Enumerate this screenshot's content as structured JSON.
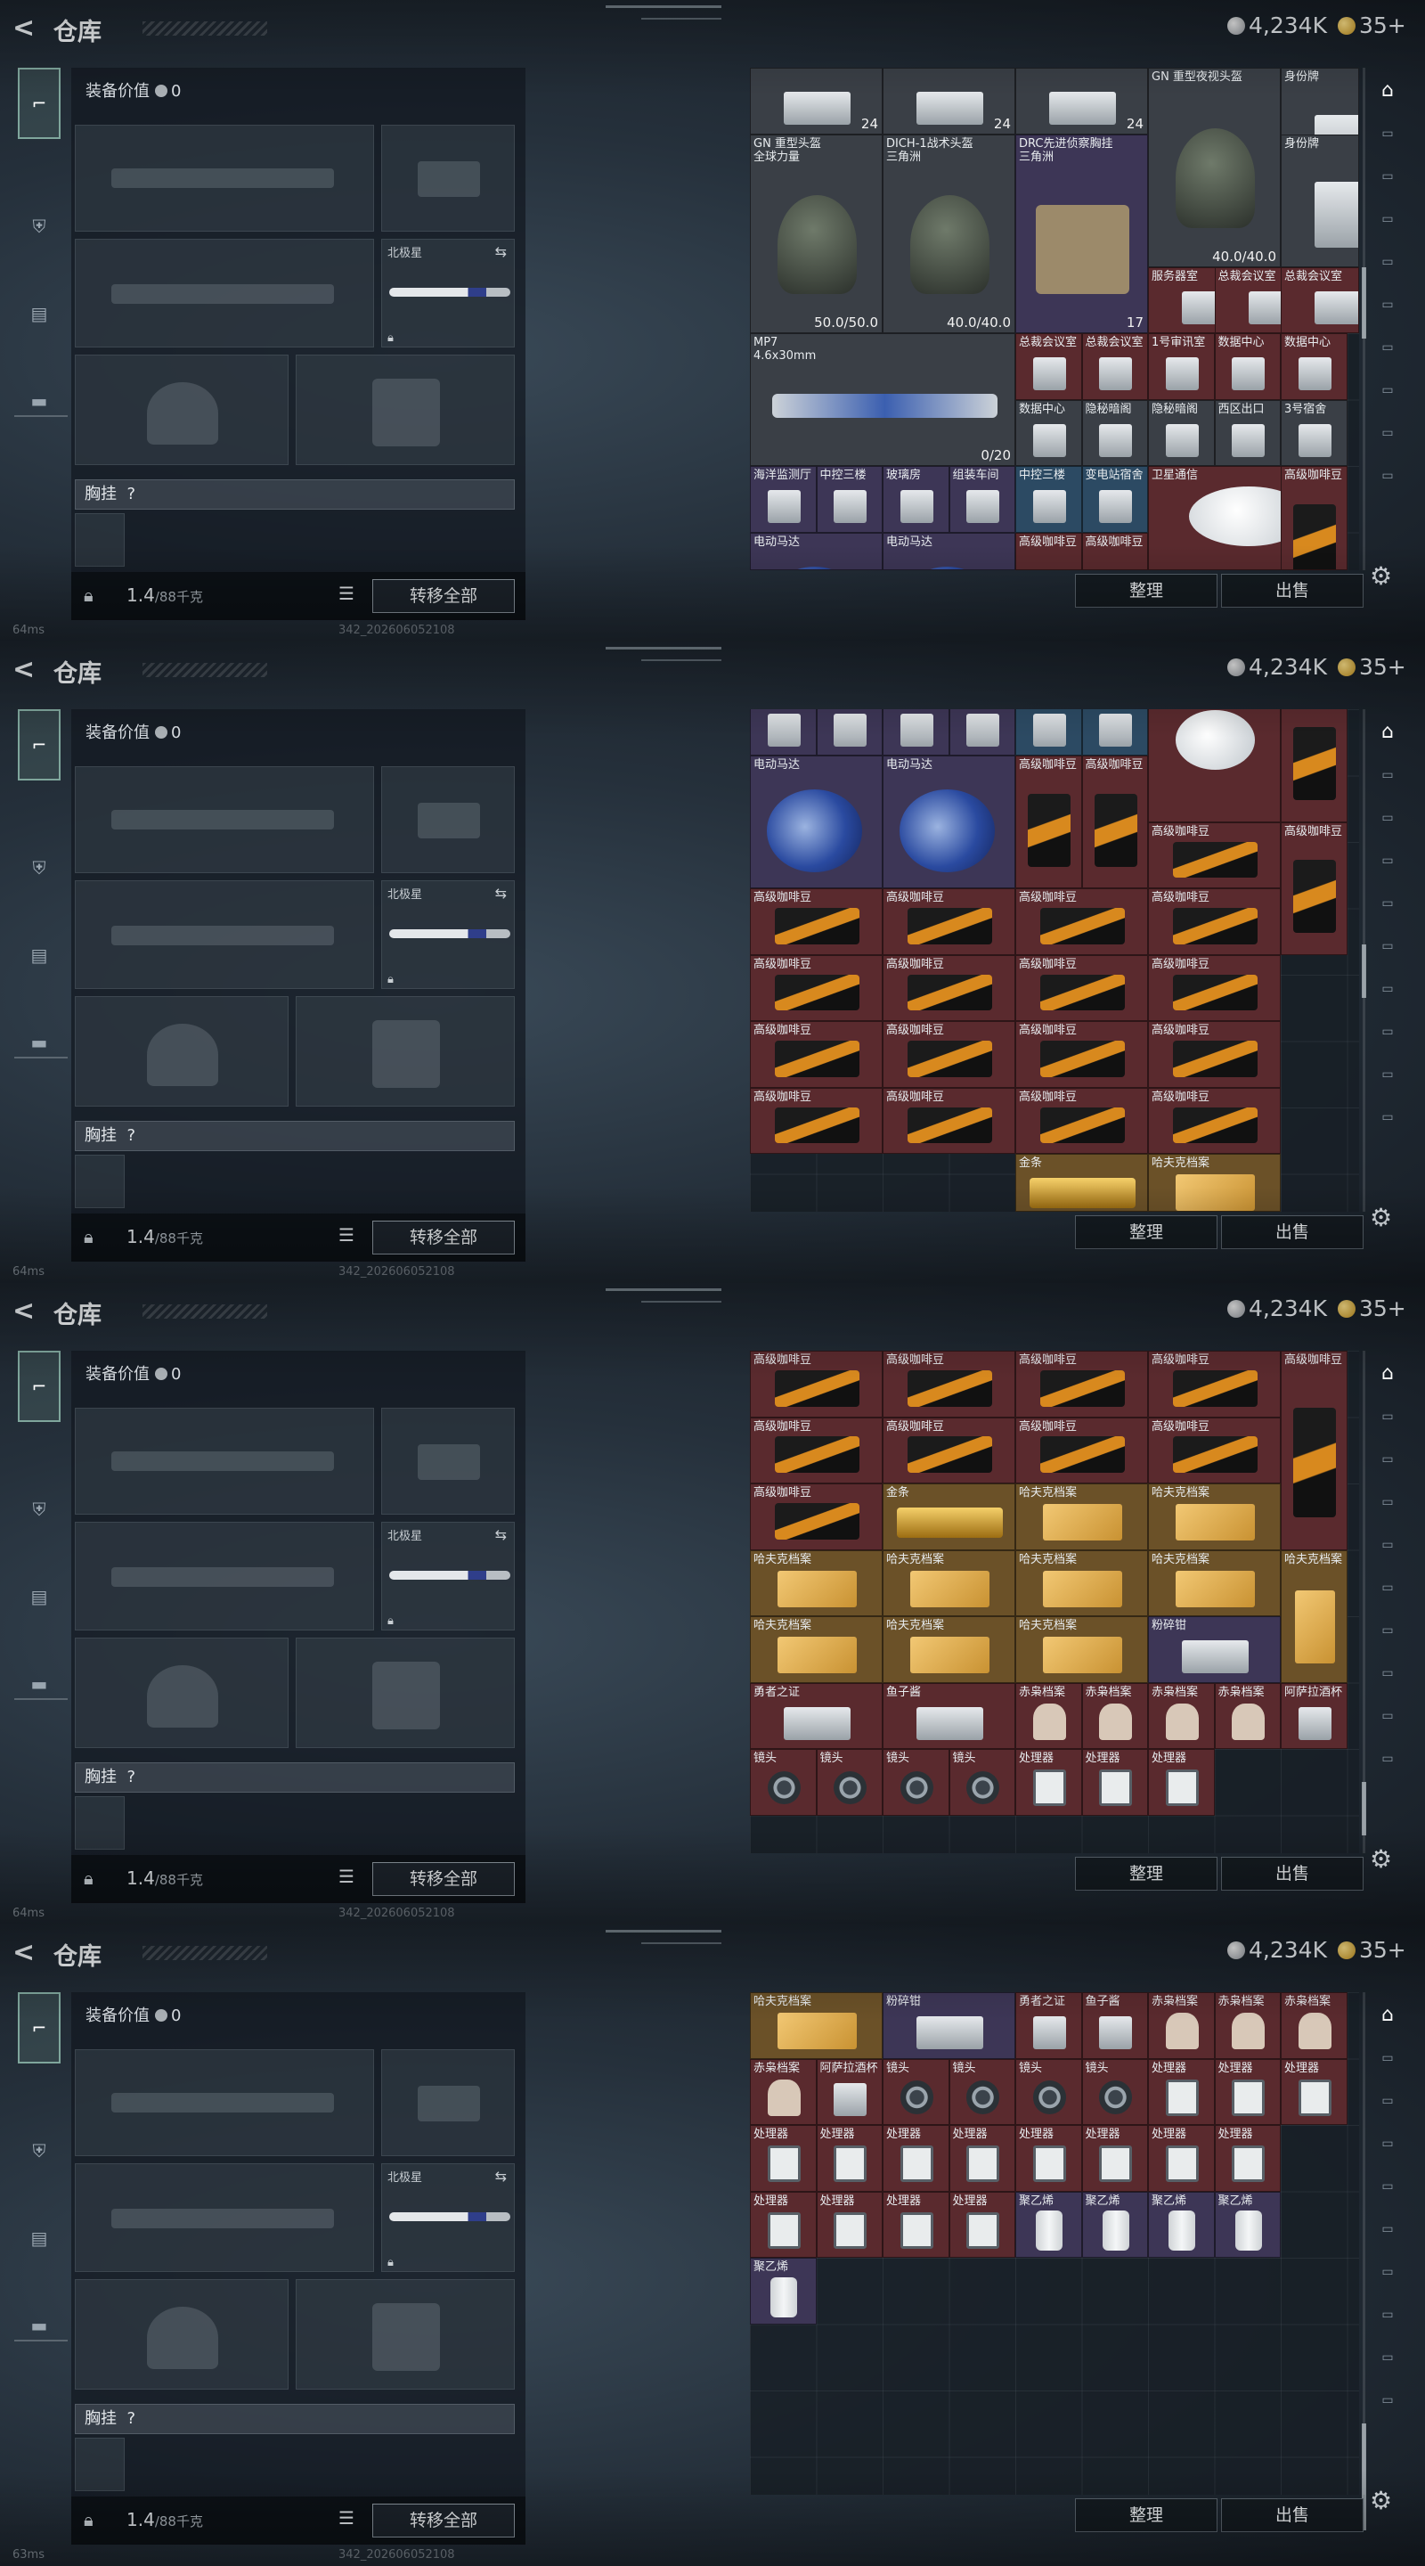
{
  "header": {
    "title": "仓库",
    "currency_silver": "4,234K",
    "currency_gold": "35+"
  },
  "equipment": {
    "value_label": "装备价值",
    "value": "0",
    "melee_label": "北极星",
    "chest_label": "胸挂",
    "chest_hint": "?",
    "weight": "1.4",
    "weight_max": "/88千克",
    "transfer_all": "转移全部"
  },
  "stash": {
    "sort_label": "整理",
    "sell_label": "出售"
  },
  "status": {
    "ping_1": "64ms",
    "ping_4": "63ms",
    "build": "342_202606052108"
  },
  "icons": [
    "back-icon",
    "pistol-icon",
    "armor-icon",
    "backpack-icon",
    "case-icon",
    "lock-icon",
    "list-icon",
    "swap-icon",
    "gear-icon",
    "stash-icon",
    "silver-coin-icon",
    "gold-coin-icon"
  ],
  "screens": [
    {
      "items": [
        {
          "name": "",
          "qty": "24",
          "c": "grey"
        },
        {
          "name": "",
          "qty": "24",
          "c": "grey"
        },
        {
          "name": "",
          "qty": "24",
          "c": "grey"
        },
        {
          "name": "GN 重型夜视头盔",
          "qty": "40.0/40.0",
          "c": "grey"
        },
        {
          "name": "身份牌",
          "qty": "",
          "c": "grey"
        },
        {
          "name": "GN 重型头盔",
          "sub": "全球力量",
          "qty": "50.0/50.0",
          "c": "grey"
        },
        {
          "name": "DICH-1战术头盔",
          "sub": "三角洲",
          "qty": "40.0/40.0",
          "c": "grey"
        },
        {
          "name": "DRC先进侦察胸挂",
          "sub": "三角洲",
          "qty": "17",
          "c": "purple"
        },
        {
          "name": "身份牌",
          "qty": "",
          "c": "grey"
        },
        {
          "name": "服务器室",
          "qty": "",
          "c": "red"
        },
        {
          "name": "总裁会议室",
          "qty": "",
          "c": "red"
        },
        {
          "name": "总裁会议室",
          "qty": "",
          "c": "red"
        },
        {
          "name": "MP7",
          "sub": "4.6x30mm",
          "qty": "0/20",
          "c": "grey"
        },
        {
          "name": "总裁会议室",
          "qty": "",
          "c": "red"
        },
        {
          "name": "总裁会议室",
          "qty": "",
          "c": "red"
        },
        {
          "name": "1号审讯室",
          "qty": "",
          "c": "red"
        },
        {
          "name": "数据中心",
          "qty": "",
          "c": "red"
        },
        {
          "name": "数据中心",
          "qty": "",
          "c": "red"
        },
        {
          "name": "数据中心",
          "qty": "",
          "c": "grey"
        },
        {
          "name": "隐秘暗阁",
          "qty": "",
          "c": "grey"
        },
        {
          "name": "隐秘暗阁",
          "qty": "",
          "c": "grey"
        },
        {
          "name": "西区出口",
          "qty": "",
          "c": "grey"
        },
        {
          "name": "3号宿舍",
          "qty": "",
          "c": "grey"
        },
        {
          "name": "海洋监测厅",
          "qty": "",
          "c": "purple"
        },
        {
          "name": "中控三楼",
          "qty": "",
          "c": "purple"
        },
        {
          "name": "玻璃房",
          "qty": "",
          "c": "purple"
        },
        {
          "name": "组装车间",
          "qty": "",
          "c": "purple"
        },
        {
          "name": "中控三楼",
          "qty": "",
          "c": "blue"
        },
        {
          "name": "变电站宿舍",
          "qty": "",
          "c": "blue"
        },
        {
          "name": "卫星通信",
          "qty": "",
          "c": "red"
        },
        {
          "name": "高级咖啡豆",
          "qty": "",
          "c": "red"
        },
        {
          "name": "电动马达",
          "qty": "",
          "c": "purple"
        },
        {
          "name": "电动马达",
          "qty": "",
          "c": "purple"
        },
        {
          "name": "高级咖啡豆",
          "qty": "",
          "c": "red"
        },
        {
          "name": "高级咖啡豆",
          "qty": "",
          "c": "red"
        },
        {
          "name": "高级咖啡豆",
          "qty": "",
          "c": "red"
        }
      ]
    },
    {
      "items": [
        {
          "name": "海洋监测厅",
          "c": "purple"
        },
        {
          "name": "中控三楼",
          "c": "purple"
        },
        {
          "name": "玻璃房",
          "c": "purple"
        },
        {
          "name": "组装车间",
          "c": "purple"
        },
        {
          "name": "中控三楼",
          "c": "blue"
        },
        {
          "name": "变电站宿舍",
          "c": "blue"
        },
        {
          "name": "卫星通信",
          "c": "red"
        },
        {
          "name": "高级咖啡豆",
          "c": "red"
        },
        {
          "name": "电动马达",
          "c": "purple"
        },
        {
          "name": "电动马达",
          "c": "purple"
        },
        {
          "name": "高级咖啡豆",
          "c": "red"
        },
        {
          "name": "高级咖啡豆",
          "c": "red"
        },
        {
          "name": "高级咖啡豆",
          "c": "red"
        },
        {
          "name": "高级咖啡豆",
          "c": "red"
        },
        {
          "name": "高级咖啡豆",
          "c": "red"
        },
        {
          "name": "高级咖啡豆",
          "c": "red"
        },
        {
          "name": "高级咖啡豆",
          "c": "red"
        },
        {
          "name": "高级咖啡豆",
          "c": "red"
        },
        {
          "name": "高级咖啡豆",
          "c": "red"
        },
        {
          "name": "高级咖啡豆",
          "c": "red"
        },
        {
          "name": "高级咖啡豆",
          "c": "red"
        },
        {
          "name": "高级咖啡豆",
          "c": "red"
        },
        {
          "name": "高级咖啡豆",
          "c": "red"
        },
        {
          "name": "高级咖啡豆",
          "c": "red"
        },
        {
          "name": "高级咖啡豆",
          "c": "red"
        },
        {
          "name": "高级咖啡豆",
          "c": "red"
        },
        {
          "name": "高级咖啡豆",
          "c": "red"
        },
        {
          "name": "高级咖啡豆",
          "c": "red"
        },
        {
          "name": "高级咖啡豆",
          "c": "red"
        },
        {
          "name": "高级咖啡豆",
          "c": "red"
        },
        {
          "name": "金条",
          "c": "gold"
        },
        {
          "name": "哈夫克档案",
          "c": "gold"
        }
      ]
    },
    {
      "items": [
        {
          "name": "高级咖啡豆",
          "c": "red"
        },
        {
          "name": "高级咖啡豆",
          "c": "red"
        },
        {
          "name": "高级咖啡豆",
          "c": "red"
        },
        {
          "name": "高级咖啡豆",
          "c": "red"
        },
        {
          "name": "高级咖啡豆",
          "c": "red"
        },
        {
          "name": "高级咖啡豆",
          "c": "red"
        },
        {
          "name": "高级咖啡豆",
          "c": "red"
        },
        {
          "name": "高级咖啡豆",
          "c": "red"
        },
        {
          "name": "高级咖啡豆",
          "c": "red"
        },
        {
          "name": "高级咖啡豆",
          "c": "red"
        },
        {
          "name": "金条",
          "c": "gold"
        },
        {
          "name": "哈夫克档案",
          "c": "gold"
        },
        {
          "name": "哈夫克档案",
          "c": "gold"
        },
        {
          "name": "哈夫克档案",
          "c": "gold"
        },
        {
          "name": "哈夫克档案",
          "c": "gold"
        },
        {
          "name": "哈夫克档案",
          "c": "gold"
        },
        {
          "name": "哈夫克档案",
          "c": "gold"
        },
        {
          "name": "哈夫克档案",
          "c": "gold"
        },
        {
          "name": "哈夫克档案",
          "c": "gold"
        },
        {
          "name": "哈夫克档案",
          "c": "gold"
        },
        {
          "name": "哈夫克档案",
          "c": "gold"
        },
        {
          "name": "粉碎钳",
          "c": "purple"
        },
        {
          "name": "勇者之证",
          "c": "red"
        },
        {
          "name": "鱼子酱",
          "c": "red"
        },
        {
          "name": "赤枭档案",
          "c": "red"
        },
        {
          "name": "赤枭档案",
          "c": "red"
        },
        {
          "name": "赤枭档案",
          "c": "red"
        },
        {
          "name": "赤枭档案",
          "c": "red"
        },
        {
          "name": "阿萨拉酒杯",
          "c": "red"
        },
        {
          "name": "镜头",
          "c": "red"
        },
        {
          "name": "镜头",
          "c": "red"
        },
        {
          "name": "镜头",
          "c": "red"
        },
        {
          "name": "镜头",
          "c": "red"
        },
        {
          "name": "处理器",
          "c": "red"
        },
        {
          "name": "处理器",
          "c": "red"
        },
        {
          "name": "处理器",
          "c": "red"
        }
      ]
    },
    {
      "items": [
        {
          "name": "哈夫克档案",
          "c": "gold"
        },
        {
          "name": "粉碎钳",
          "c": "purple"
        },
        {
          "name": "勇者之证",
          "c": "red"
        },
        {
          "name": "鱼子酱",
          "c": "red"
        },
        {
          "name": "赤枭档案",
          "c": "red"
        },
        {
          "name": "赤枭档案",
          "c": "red"
        },
        {
          "name": "赤枭档案",
          "c": "red"
        },
        {
          "name": "赤枭档案",
          "c": "red"
        },
        {
          "name": "阿萨拉酒杯",
          "c": "red"
        },
        {
          "name": "镜头",
          "c": "red"
        },
        {
          "name": "镜头",
          "c": "red"
        },
        {
          "name": "镜头",
          "c": "red"
        },
        {
          "name": "镜头",
          "c": "red"
        },
        {
          "name": "处理器",
          "c": "red"
        },
        {
          "name": "处理器",
          "c": "red"
        },
        {
          "name": "处理器",
          "c": "red"
        },
        {
          "name": "处理器",
          "c": "red"
        },
        {
          "name": "处理器",
          "c": "red"
        },
        {
          "name": "处理器",
          "c": "red"
        },
        {
          "name": "处理器",
          "c": "red"
        },
        {
          "name": "处理器",
          "c": "red"
        },
        {
          "name": "处理器",
          "c": "red"
        },
        {
          "name": "处理器",
          "c": "red"
        },
        {
          "name": "处理器",
          "c": "red"
        },
        {
          "name": "处理器",
          "c": "red"
        },
        {
          "name": "处理器",
          "c": "red"
        },
        {
          "name": "处理器",
          "c": "red"
        },
        {
          "name": "处理器",
          "c": "red"
        },
        {
          "name": "聚乙烯",
          "c": "purple"
        },
        {
          "name": "聚乙烯",
          "c": "purple"
        },
        {
          "name": "聚乙烯",
          "c": "purple"
        },
        {
          "name": "聚乙烯",
          "c": "purple"
        },
        {
          "name": "聚乙烯",
          "c": "purple"
        }
      ]
    }
  ]
}
